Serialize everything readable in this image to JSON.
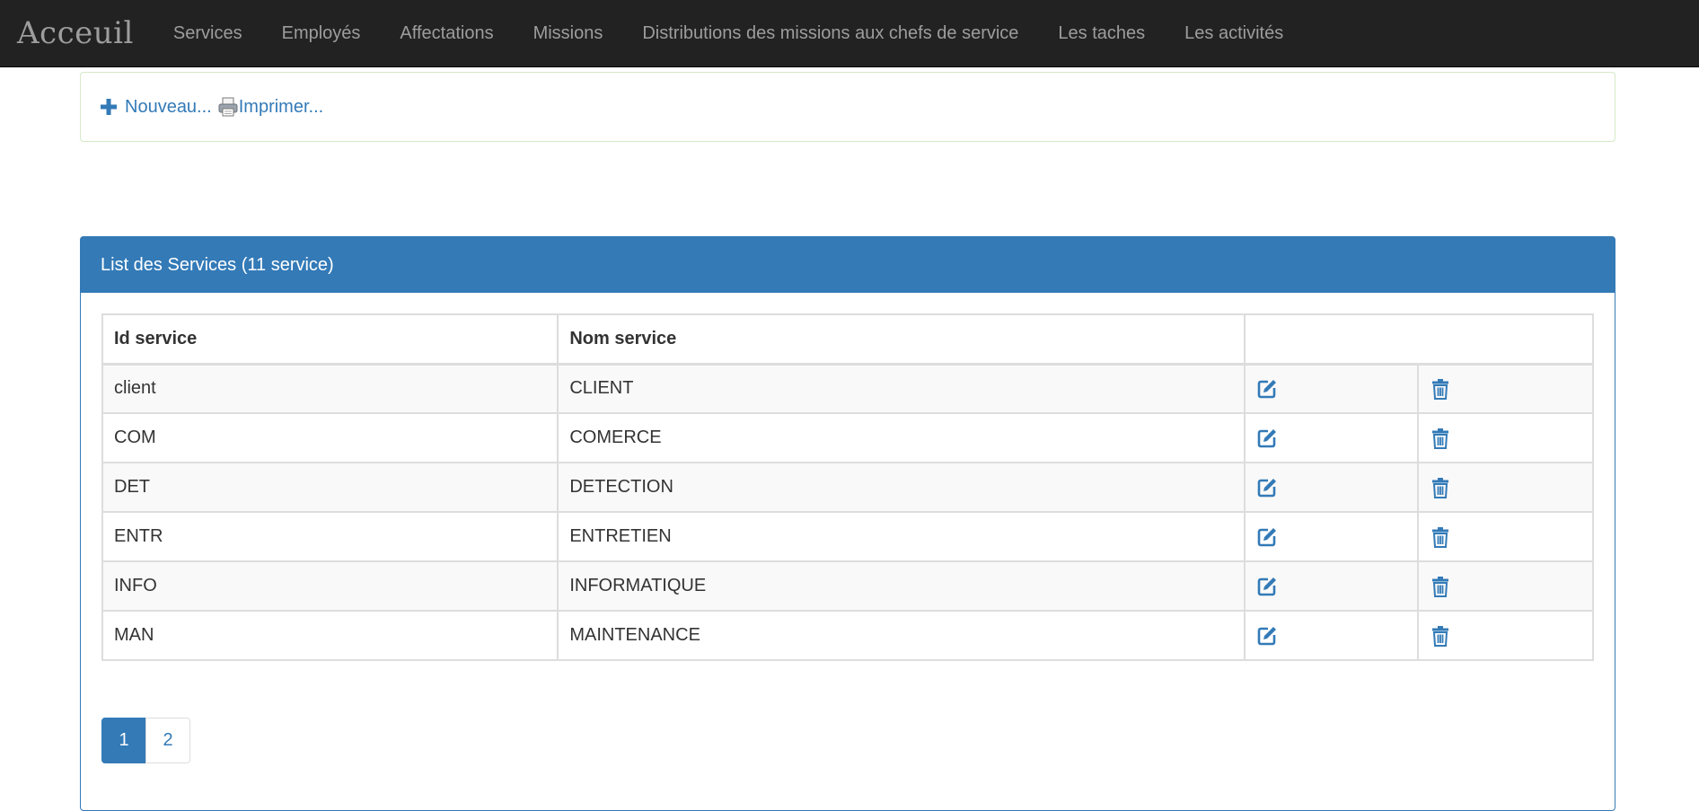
{
  "navbar": {
    "brand": "Acceuil",
    "items": [
      {
        "label": "Services"
      },
      {
        "label": "Employés"
      },
      {
        "label": "Affectations"
      },
      {
        "label": "Missions"
      },
      {
        "label": "Distributions des missions aux chefs de service"
      },
      {
        "label": "Les taches"
      },
      {
        "label": "Les activités"
      }
    ]
  },
  "toolbar": {
    "new_label": "Nouveau...",
    "print_label": "Imprimer..."
  },
  "panel": {
    "title": "List des Services (11 service)",
    "columns": [
      "Id service",
      "Nom service",
      ""
    ],
    "rows": [
      {
        "id": "client",
        "name": "CLIENT"
      },
      {
        "id": "COM",
        "name": "COMERCE"
      },
      {
        "id": "DET",
        "name": "DETECTION"
      },
      {
        "id": "ENTR",
        "name": "ENTRETIEN"
      },
      {
        "id": "INFO",
        "name": "INFORMATIQUE"
      },
      {
        "id": "MAN",
        "name": "MAINTENANCE"
      }
    ],
    "row_actions": [
      "edit-icon",
      "trash-icon"
    ]
  },
  "pagination": {
    "pages": [
      "1",
      "2"
    ],
    "current": "1"
  },
  "colors": {
    "navbar_bg": "#222222",
    "nav_text": "#9d9d9d",
    "primary": "#337ab7",
    "toolbar_border": "#d6e9c6"
  }
}
